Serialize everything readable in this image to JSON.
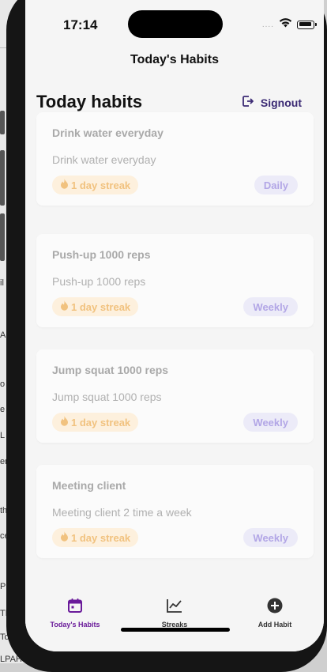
{
  "background_fragments": [
    "il",
    "A",
    "o",
    "e",
    "L",
    "er",
    "th",
    "ce",
    "P",
    "TF",
    "Toll",
    "LPAH"
  ],
  "status_bar": {
    "time": "17:14",
    "signal": "....",
    "wifi_icon": "wifi-icon",
    "battery_icon": "battery-icon"
  },
  "nav": {
    "title": "Today's Habits"
  },
  "header": {
    "title": "Today habits",
    "signout_label": "Signout"
  },
  "habits": [
    {
      "title": "Drink water everyday",
      "description": "Drink water everyday",
      "streak": "1 day streak",
      "frequency": "Daily"
    },
    {
      "title": "Push-up 1000 reps",
      "description": "Push-up 1000 reps",
      "streak": "1 day streak",
      "frequency": "Weekly"
    },
    {
      "title": "Jump squat 1000 reps",
      "description": "Jump squat 1000 reps",
      "streak": "1 day streak",
      "frequency": "Weekly"
    },
    {
      "title": "Meeting client",
      "description": "Meeting client 2 time a week",
      "streak": "1 day streak",
      "frequency": "Weekly"
    }
  ],
  "tabs": [
    {
      "label": "Today's Habits",
      "icon": "calendar-icon",
      "active": true
    },
    {
      "label": "Streaks",
      "icon": "chart-icon",
      "active": false
    },
    {
      "label": "Add Habit",
      "icon": "plus-circle-icon",
      "active": false
    }
  ],
  "colors": {
    "accent": "#6a1b9a",
    "streak_text": "#f1c27f",
    "streak_bg": "#fdf0dd",
    "freq_text": "#b2a6e6",
    "freq_bg": "#ecebf8",
    "signout": "#3b2a74"
  }
}
